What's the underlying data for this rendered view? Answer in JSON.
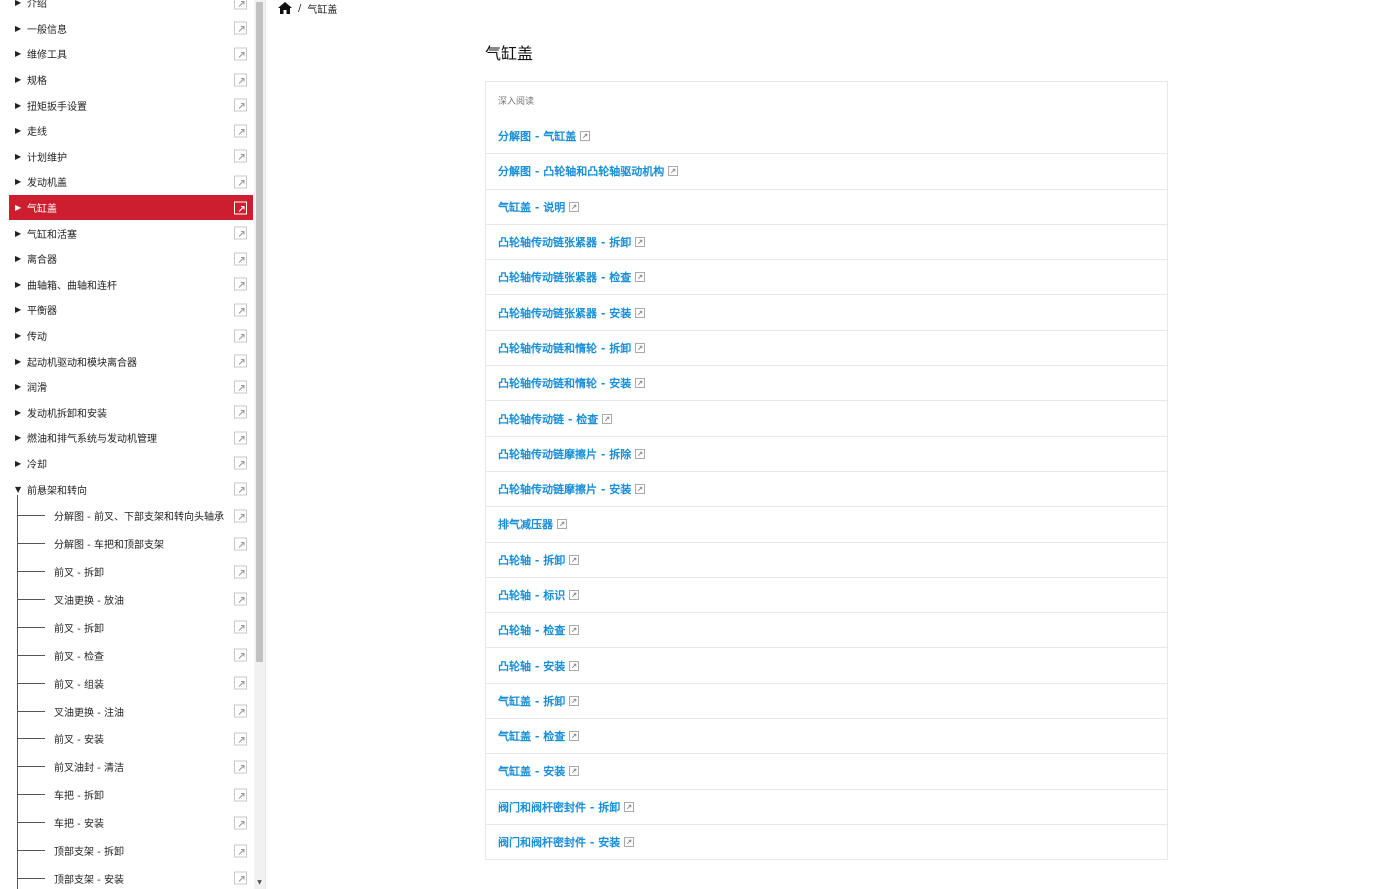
{
  "breadcrumb": {
    "current": "气缸盖"
  },
  "sidebar": {
    "items": [
      {
        "label": "介绍",
        "expanded": false,
        "active": false
      },
      {
        "label": "一般信息",
        "expanded": false,
        "active": false
      },
      {
        "label": "维修工具",
        "expanded": false,
        "active": false
      },
      {
        "label": "规格",
        "expanded": false,
        "active": false
      },
      {
        "label": "扭矩扳手设置",
        "expanded": false,
        "active": false
      },
      {
        "label": "走线",
        "expanded": false,
        "active": false
      },
      {
        "label": "计划维护",
        "expanded": false,
        "active": false
      },
      {
        "label": "发动机盖",
        "expanded": false,
        "active": false
      },
      {
        "label": "气缸盖",
        "expanded": false,
        "active": true
      },
      {
        "label": "气缸和活塞",
        "expanded": false,
        "active": false
      },
      {
        "label": "离合器",
        "expanded": false,
        "active": false
      },
      {
        "label": "曲轴箱、曲轴和连杆",
        "expanded": false,
        "active": false
      },
      {
        "label": "平衡器",
        "expanded": false,
        "active": false
      },
      {
        "label": "传动",
        "expanded": false,
        "active": false
      },
      {
        "label": "起动机驱动和模块离合器",
        "expanded": false,
        "active": false
      },
      {
        "label": "润滑",
        "expanded": false,
        "active": false
      },
      {
        "label": "发动机拆卸和安装",
        "expanded": false,
        "active": false
      },
      {
        "label": "燃油和排气系统与发动机管理",
        "expanded": false,
        "active": false
      },
      {
        "label": "冷却",
        "expanded": false,
        "active": false
      },
      {
        "label": "前悬架和转向",
        "expanded": true,
        "active": false
      }
    ],
    "children": [
      "分解图 - 前叉、下部支架和转向头轴承",
      "分解图 - 车把和顶部支架",
      "前叉 - 拆卸",
      "叉油更换 - 放油",
      "前叉 - 拆卸",
      "前叉 - 检查",
      "前叉 - 组装",
      "叉油更换 - 注油",
      "前叉 - 安装",
      "前叉油封 - 清洁",
      "车把 - 拆卸",
      "车把 - 安装",
      "顶部支架 - 拆卸",
      "顶部支架 - 安装"
    ]
  },
  "main": {
    "title": "气缸盖",
    "panel_header": "深入阅读",
    "links": [
      "分解图 - 气缸盖",
      "分解图 - 凸轮轴和凸轮轴驱动机构",
      "气缸盖 - 说明",
      "凸轮轴传动链张紧器 - 拆卸",
      "凸轮轴传动链张紧器 - 检查",
      "凸轮轴传动链张紧器 - 安装",
      "凸轮轴传动链和惰轮 - 拆卸",
      "凸轮轴传动链和惰轮 - 安装",
      "凸轮轴传动链 - 检查",
      "凸轮轴传动链摩擦片 - 拆除",
      "凸轮轴传动链摩擦片 - 安装",
      "排气减压器",
      "凸轮轴 - 拆卸",
      "凸轮轴 - 标识",
      "凸轮轴 - 检查",
      "凸轮轴 - 安装",
      "气缸盖 - 拆卸",
      "气缸盖 - 检查",
      "气缸盖 - 安装",
      "阀门和阀杆密封件 - 拆卸",
      "阀门和阀杆密封件 - 安装"
    ]
  },
  "colors": {
    "active": "#cc1e2f",
    "link": "#1a8fd8"
  },
  "icons": {
    "home": "home-icon",
    "external": "external-link-icon"
  }
}
